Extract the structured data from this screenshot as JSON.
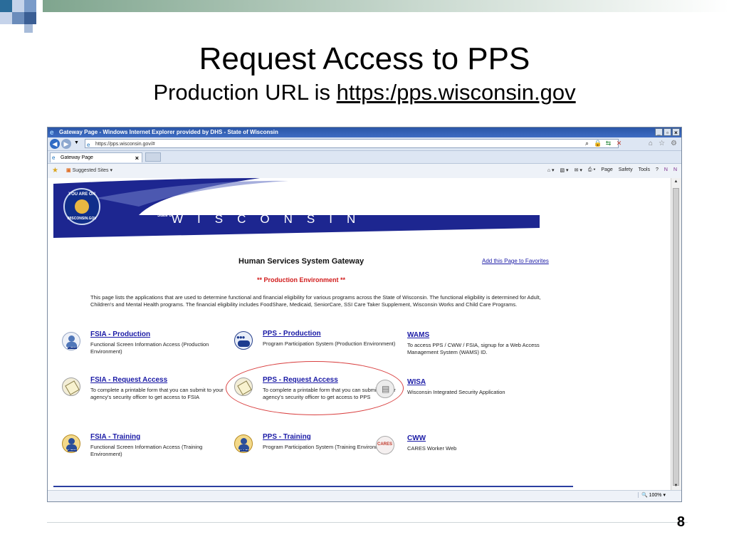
{
  "slide": {
    "title": "Request Access to PPS",
    "subtitle_prefix": "Production URL is ",
    "subtitle_link": "https:/pps.wisconsin.gov",
    "page_number": "8"
  },
  "browser": {
    "window_title": "Gateway Page - Windows Internet Explorer provided by DHS - State of Wisconsin",
    "address": "https://pps.wisconsin.gov/#",
    "tab_label": "Gateway Page",
    "suggested_sites": "Suggested Sites",
    "commands": [
      "Page",
      "Safety",
      "Tools"
    ],
    "zoom": "100%"
  },
  "page": {
    "state_of": "State of",
    "state_name": "WISCONSIN",
    "seal_top": "YOU ARE ON",
    "seal_bottom": "WISCONSIN.GOV",
    "gateway_title": "Human Services System Gateway",
    "favorites_link": "Add this Page to Favorites",
    "environment": "** Production Environment **",
    "intro": "This page lists the applications that are used to determine functional and financial eligibility for various programs across the State of Wisconsin. The functional eligibility is determined for Adult, Children's and Mental Health programs. The financial eligibility includes FoodShare, Medicaid, SeniorCare, SSI Care Taker Supplement, Wisconsin Works and Child Care Programs.",
    "apps": [
      {
        "name": "FSIA - Production",
        "desc": "Functional Screen Information Access (Production Environment)",
        "icon": "person-icon",
        "badge": "FSIA"
      },
      {
        "name": "PPS - Production",
        "desc": "Program Participation System (Production Environment)",
        "icon": "group-icon",
        "badge": "PPS"
      },
      {
        "name": "WAMS",
        "desc": "To access PPS / CWW / FSIA, signup for a Web Access Management System (WAMS) ID.",
        "icon": "",
        "badge": ""
      },
      {
        "name": "FSIA - Request Access",
        "desc": "To complete a printable form that you can submit to your agency's security officer to get access to FSIA",
        "icon": "form-icon",
        "badge": ""
      },
      {
        "name": "PPS - Request Access",
        "desc": "To complete a printable form that you can submit to your agency's security officer to get access to PPS",
        "icon": "form-icon",
        "badge": ""
      },
      {
        "name": "WISA",
        "desc": "Wisconsin Integrated Security Application",
        "icon": "lock-icon",
        "badge": ""
      },
      {
        "name": "FSIA - Training",
        "desc": "Functional Screen Information Access (Training Environment)",
        "icon": "person-icon",
        "badge": "FSIA"
      },
      {
        "name": "PPS - Training",
        "desc": "Program Participation System (Training Environment)",
        "icon": "group-icon",
        "badge": "PPS"
      },
      {
        "name": "CWW",
        "desc": "CARES Worker Web",
        "icon": "cares-icon",
        "badge": "CARES"
      }
    ]
  },
  "colors": {
    "link": "#1a1aa6",
    "banner": "#1d2690",
    "environment": "#d11a1a",
    "highlight": "#d94040"
  }
}
